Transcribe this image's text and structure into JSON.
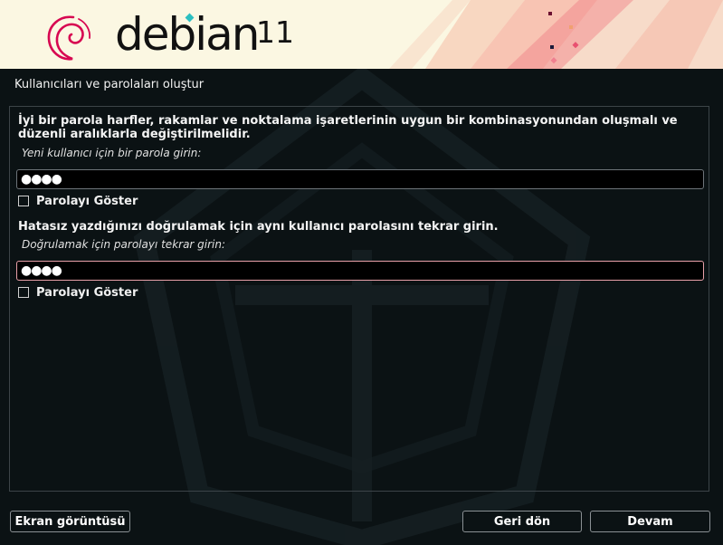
{
  "banner": {
    "brand": "debian",
    "version": "11"
  },
  "page": {
    "title": "Kullanıcıları ve parolaları oluştur"
  },
  "form": {
    "description": "İyi bir parola harfler, rakamlar ve noktalama işaretlerinin uygun bir kombinasyonundan oluşmalı ve düzenli aralıklarla değiştirilmelidir.",
    "password_label": "Yeni kullanıcı için bir parola girin:",
    "password_value": "●●●●",
    "show_password_label": "Parolayı Göster",
    "verify_description": "Hatasız yazdığınızı doğrulamak için aynı kullanıcı parolasını tekrar girin.",
    "verify_label": "Doğrulamak için parolayı tekrar girin:",
    "verify_value": "●●●●",
    "show_password_label_2": "Parolayı Göster"
  },
  "buttons": {
    "screenshot": "Ekran görüntüsü",
    "back": "Geri dön",
    "continue": "Devam"
  },
  "colors": {
    "background": "#0b1214",
    "banner": "#fbf7e2",
    "swirl": "#d70751",
    "focus_border": "#e8a0a8"
  },
  "icons": {
    "logo": "debian-swirl-icon"
  }
}
